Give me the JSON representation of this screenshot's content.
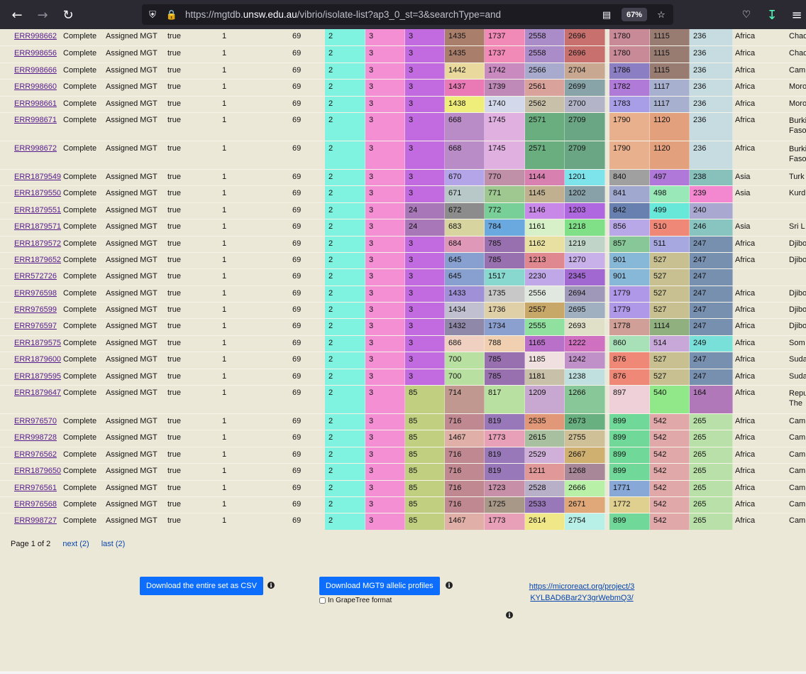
{
  "browser": {
    "url_prefix": "https://mgtdb.",
    "url_host": "unsw.edu.au",
    "url_rest": "/vibrio/isolate-list?ap3_0_st=3&searchType=and",
    "zoom": "67%",
    "icons": [
      "back-icon",
      "forward-icon",
      "reload-icon",
      "shield-icon",
      "lock-icon",
      "reader-view-icon",
      "bookmark-star-icon",
      "pocket-icon",
      "download-icon",
      "menu-icon"
    ]
  },
  "rows": [
    {
      "acc": "ERR998662",
      "status": "Complete",
      "assign": "Assigned MGT",
      "flag": "true",
      "one": "1",
      "st": "69",
      "vals": [
        "2",
        "3",
        "3",
        "1435",
        "1737",
        "2558",
        "2696",
        "1780",
        "1115",
        "236"
      ],
      "region": "Africa",
      "country": "Chad"
    },
    {
      "acc": "ERR998656",
      "status": "Complete",
      "assign": "Assigned MGT",
      "flag": "true",
      "one": "1",
      "st": "69",
      "vals": [
        "2",
        "3",
        "3",
        "1435",
        "1737",
        "2558",
        "2696",
        "1780",
        "1115",
        "236"
      ],
      "region": "Africa",
      "country": "Chad"
    },
    {
      "acc": "ERR998666",
      "status": "Complete",
      "assign": "Assigned MGT",
      "flag": "true",
      "one": "1",
      "st": "69",
      "vals": [
        "2",
        "3",
        "3",
        "1442",
        "1742",
        "2566",
        "2704",
        "1786",
        "1115",
        "236"
      ],
      "region": "Africa",
      "country": "Cam"
    },
    {
      "acc": "ERR998660",
      "status": "Complete",
      "assign": "Assigned MGT",
      "flag": "true",
      "one": "1",
      "st": "69",
      "vals": [
        "2",
        "3",
        "3",
        "1437",
        "1739",
        "2561",
        "2699",
        "1782",
        "1117",
        "236"
      ],
      "region": "Africa",
      "country": "Moro"
    },
    {
      "acc": "ERR998661",
      "status": "Complete",
      "assign": "Assigned MGT",
      "flag": "true",
      "one": "1",
      "st": "69",
      "vals": [
        "2",
        "3",
        "3",
        "1438",
        "1740",
        "2562",
        "2700",
        "1783",
        "1117",
        "236"
      ],
      "region": "Africa",
      "country": "Moro"
    },
    {
      "acc": "ERR998671",
      "status": "Complete",
      "assign": "Assigned MGT",
      "flag": "true",
      "one": "1",
      "st": "69",
      "vals": [
        "2",
        "3",
        "3",
        "668",
        "1745",
        "2571",
        "2709",
        "1790",
        "1120",
        "236"
      ],
      "region": "Africa",
      "country": "Burkina Faso"
    },
    {
      "acc": "ERR998672",
      "status": "Complete",
      "assign": "Assigned MGT",
      "flag": "true",
      "one": "1",
      "st": "69",
      "vals": [
        "2",
        "3",
        "3",
        "668",
        "1745",
        "2571",
        "2709",
        "1790",
        "1120",
        "236"
      ],
      "region": "Africa",
      "country": "Burkina Faso"
    },
    {
      "acc": "ERR1879549",
      "status": "Complete",
      "assign": "Assigned MGT",
      "flag": "true",
      "one": "1",
      "st": "69",
      "vals": [
        "2",
        "3",
        "3",
        "670",
        "770",
        "1144",
        "1201",
        "840",
        "497",
        "238"
      ],
      "region": "Asia",
      "country": "Turk"
    },
    {
      "acc": "ERR1879550",
      "status": "Complete",
      "assign": "Assigned MGT",
      "flag": "true",
      "one": "1",
      "st": "69",
      "vals": [
        "2",
        "3",
        "3",
        "671",
        "771",
        "1145",
        "1202",
        "841",
        "498",
        "239"
      ],
      "region": "Asia",
      "country": "Kurd"
    },
    {
      "acc": "ERR1879551",
      "status": "Complete",
      "assign": "Assigned MGT",
      "flag": "true",
      "one": "1",
      "st": "69",
      "vals": [
        "2",
        "3",
        "24",
        "672",
        "772",
        "1146",
        "1203",
        "842",
        "499",
        "240"
      ],
      "region": "",
      "country": ""
    },
    {
      "acc": "ERR1879571",
      "status": "Complete",
      "assign": "Assigned MGT",
      "flag": "true",
      "one": "1",
      "st": "69",
      "vals": [
        "2",
        "3",
        "24",
        "683",
        "784",
        "1161",
        "1218",
        "856",
        "510",
        "246"
      ],
      "region": "Asia",
      "country": "Sri L"
    },
    {
      "acc": "ERR1879572",
      "status": "Complete",
      "assign": "Assigned MGT",
      "flag": "true",
      "one": "1",
      "st": "69",
      "vals": [
        "2",
        "3",
        "3",
        "684",
        "785",
        "1162",
        "1219",
        "857",
        "511",
        "247"
      ],
      "region": "Africa",
      "country": "Djibo"
    },
    {
      "acc": "ERR1879652",
      "status": "Complete",
      "assign": "Assigned MGT",
      "flag": "true",
      "one": "1",
      "st": "69",
      "vals": [
        "2",
        "3",
        "3",
        "645",
        "785",
        "1213",
        "1270",
        "901",
        "527",
        "247"
      ],
      "region": "Africa",
      "country": "Djibo"
    },
    {
      "acc": "ERR572726",
      "status": "Complete",
      "assign": "Assigned MGT",
      "flag": "true",
      "one": "1",
      "st": "69",
      "vals": [
        "2",
        "3",
        "3",
        "645",
        "1517",
        "2230",
        "2345",
        "901",
        "527",
        "247"
      ],
      "region": "",
      "country": ""
    },
    {
      "acc": "ERR976598",
      "status": "Complete",
      "assign": "Assigned MGT",
      "flag": "true",
      "one": "1",
      "st": "69",
      "vals": [
        "2",
        "3",
        "3",
        "1433",
        "1735",
        "2556",
        "2694",
        "1779",
        "527",
        "247"
      ],
      "region": "Africa",
      "country": "Djibo"
    },
    {
      "acc": "ERR976599",
      "status": "Complete",
      "assign": "Assigned MGT",
      "flag": "true",
      "one": "1",
      "st": "69",
      "vals": [
        "2",
        "3",
        "3",
        "1434",
        "1736",
        "2557",
        "2695",
        "1779",
        "527",
        "247"
      ],
      "region": "Africa",
      "country": "Djibo"
    },
    {
      "acc": "ERR976597",
      "status": "Complete",
      "assign": "Assigned MGT",
      "flag": "true",
      "one": "1",
      "st": "69",
      "vals": [
        "2",
        "3",
        "3",
        "1432",
        "1734",
        "2555",
        "2693",
        "1778",
        "1114",
        "247"
      ],
      "region": "Africa",
      "country": "Djibo"
    },
    {
      "acc": "ERR1879575",
      "status": "Complete",
      "assign": "Assigned MGT",
      "flag": "true",
      "one": "1",
      "st": "69",
      "vals": [
        "2",
        "3",
        "3",
        "686",
        "788",
        "1165",
        "1222",
        "860",
        "514",
        "249"
      ],
      "region": "Africa",
      "country": "Som"
    },
    {
      "acc": "ERR1879600",
      "status": "Complete",
      "assign": "Assigned MGT",
      "flag": "true",
      "one": "1",
      "st": "69",
      "vals": [
        "2",
        "3",
        "3",
        "700",
        "785",
        "1185",
        "1242",
        "876",
        "527",
        "247"
      ],
      "region": "Africa",
      "country": "Suda"
    },
    {
      "acc": "ERR1879595",
      "status": "Complete",
      "assign": "Assigned MGT",
      "flag": "true",
      "one": "1",
      "st": "69",
      "vals": [
        "2",
        "3",
        "3",
        "700",
        "785",
        "1181",
        "1238",
        "876",
        "527",
        "247"
      ],
      "region": "Africa",
      "country": "Suda"
    },
    {
      "acc": "ERR1879647",
      "status": "Complete",
      "assign": "Assigned MGT",
      "flag": "true",
      "one": "1",
      "st": "69",
      "vals": [
        "2",
        "3",
        "85",
        "714",
        "817",
        "1209",
        "1266",
        "897",
        "540",
        "164"
      ],
      "region": "Africa",
      "country": "Repu The"
    },
    {
      "acc": "ERR976570",
      "status": "Complete",
      "assign": "Assigned MGT",
      "flag": "true",
      "one": "1",
      "st": "69",
      "vals": [
        "2",
        "3",
        "85",
        "716",
        "819",
        "2535",
        "2673",
        "899",
        "542",
        "265"
      ],
      "region": "Africa",
      "country": "Cam"
    },
    {
      "acc": "ERR998728",
      "status": "Complete",
      "assign": "Assigned MGT",
      "flag": "true",
      "one": "1",
      "st": "69",
      "vals": [
        "2",
        "3",
        "85",
        "1467",
        "1773",
        "2615",
        "2755",
        "899",
        "542",
        "265"
      ],
      "region": "Africa",
      "country": "Cam"
    },
    {
      "acc": "ERR976562",
      "status": "Complete",
      "assign": "Assigned MGT",
      "flag": "true",
      "one": "1",
      "st": "69",
      "vals": [
        "2",
        "3",
        "85",
        "716",
        "819",
        "2529",
        "2667",
        "899",
        "542",
        "265"
      ],
      "region": "Africa",
      "country": "Cam"
    },
    {
      "acc": "ERR1879650",
      "status": "Complete",
      "assign": "Assigned MGT",
      "flag": "true",
      "one": "1",
      "st": "69",
      "vals": [
        "2",
        "3",
        "85",
        "716",
        "819",
        "1211",
        "1268",
        "899",
        "542",
        "265"
      ],
      "region": "Africa",
      "country": "Cam"
    },
    {
      "acc": "ERR976561",
      "status": "Complete",
      "assign": "Assigned MGT",
      "flag": "true",
      "one": "1",
      "st": "69",
      "vals": [
        "2",
        "3",
        "85",
        "716",
        "1723",
        "2528",
        "2666",
        "1771",
        "542",
        "265"
      ],
      "region": "Africa",
      "country": "Cam"
    },
    {
      "acc": "ERR976568",
      "status": "Complete",
      "assign": "Assigned MGT",
      "flag": "true",
      "one": "1",
      "st": "69",
      "vals": [
        "2",
        "3",
        "85",
        "716",
        "1725",
        "2533",
        "2671",
        "1772",
        "542",
        "265"
      ],
      "region": "Africa",
      "country": "Cam"
    },
    {
      "acc": "ERR998727",
      "status": "Complete",
      "assign": "Assigned MGT",
      "flag": "true",
      "one": "1",
      "st": "69",
      "vals": [
        "2",
        "3",
        "85",
        "1467",
        "1773",
        "2614",
        "2754",
        "899",
        "542",
        "265"
      ],
      "region": "Africa",
      "country": "Cam"
    }
  ],
  "cell_colors": [
    [
      "#7ff2e0",
      "#f48fd4",
      "#c26be0",
      "#a97f6c",
      "#f28ab8",
      "#a98cc8",
      "#c8706e",
      "#c98a98",
      "#987c72",
      "#c7dce0"
    ],
    [
      "#7ff2e0",
      "#f48fd4",
      "#c26be0",
      "#a97f6c",
      "#f28ab8",
      "#a98cc8",
      "#c8706e",
      "#c98a98",
      "#987c72",
      "#c7dce0"
    ],
    [
      "#7ff2e0",
      "#f48fd4",
      "#c26be0",
      "#e9d99c",
      "#c98ac0",
      "#a9abce",
      "#c8a890",
      "#8c7ec2",
      "#987c72",
      "#c7dce0"
    ],
    [
      "#7ff2e0",
      "#f48fd4",
      "#c26be0",
      "#e97ab6",
      "#c08ab8",
      "#d9a39c",
      "#88a4a8",
      "#b07ad8",
      "#a8b0d0",
      "#c7dce0"
    ],
    [
      "#7ff2e0",
      "#f48fd4",
      "#c26be0",
      "#f0ee7a",
      "#d3d8ea",
      "#c8c0a8",
      "#b4b4c8",
      "#a89ee8",
      "#a8b0d0",
      "#c7dce0"
    ],
    [
      "#7ff2e0",
      "#f48fd4",
      "#c26be0",
      "#b98cc8",
      "#e0b0e0",
      "#6aae80",
      "#6aa684",
      "#e8b08c",
      "#e2a07c",
      "#c7dce0"
    ],
    [
      "#7ff2e0",
      "#f48fd4",
      "#c26be0",
      "#b98cc8",
      "#e0b0e0",
      "#6aae80",
      "#6aa684",
      "#e8b08c",
      "#e2a07c",
      "#c7dce0"
    ],
    [
      "#7ff2e0",
      "#f48fd4",
      "#c26be0",
      "#b4a4e8",
      "#c090a8",
      "#d880b0",
      "#7ee4ec",
      "#a0a0a0",
      "#b078d8",
      "#88c0bc"
    ],
    [
      "#7ff2e0",
      "#f48fd4",
      "#c26be0",
      "#b8c8c8",
      "#9ec890",
      "#c0b090",
      "#88a0a8",
      "#a0a8d0",
      "#98e8b8",
      "#f488d0"
    ],
    [
      "#7ff2e0",
      "#f48fd4",
      "#a877b8",
      "#8c8c8c",
      "#78d098",
      "#c888e8",
      "#b068e0",
      "#6880b0",
      "#68e8d8",
      "#a8a8d0"
    ],
    [
      "#7ff2e0",
      "#f48fd4",
      "#a877b8",
      "#d8d4a0",
      "#6aa8e0",
      "#d8f0c8",
      "#80e088",
      "#b8a8e8",
      "#f08878",
      "#88c4c0"
    ],
    [
      "#7ff2e0",
      "#f48fd4",
      "#c26be0",
      "#e098b8",
      "#9870b0",
      "#e8e0a0",
      "#c0d4c8",
      "#88c898",
      "#a8a8e0",
      "#7890b0"
    ],
    [
      "#7ff2e0",
      "#f48fd4",
      "#c26be0",
      "#88a0d0",
      "#9870b0",
      "#e08890",
      "#c8b0e8",
      "#88b8d8",
      "#c8c090",
      "#7890b0"
    ],
    [
      "#7ff2e0",
      "#f48fd4",
      "#c26be0",
      "#88a0d0",
      "#88d8d0",
      "#c0a8e8",
      "#a068d0",
      "#88b8d8",
      "#c8c090",
      "#7890b0"
    ],
    [
      "#7ff2e0",
      "#f48fd4",
      "#c26be0",
      "#a090d8",
      "#c8c8c8",
      "#e0e8e0",
      "#a098b8",
      "#b098e8",
      "#c8c090",
      "#7890b0"
    ],
    [
      "#7ff2e0",
      "#f48fd4",
      "#c26be0",
      "#c0c0d0",
      "#e0d0a8",
      "#c8a868",
      "#a0b0c0",
      "#b098e8",
      "#c8c090",
      "#7890b0"
    ],
    [
      "#7ff2e0",
      "#f48fd4",
      "#c26be0",
      "#9088a8",
      "#8ca0d0",
      "#90e0a0",
      "#e0e0c8",
      "#d0a098",
      "#90b080",
      "#7890b0"
    ],
    [
      "#7ff2e0",
      "#f48fd4",
      "#c26be0",
      "#f0d0c0",
      "#f0d0b0",
      "#b870c8",
      "#d070c0",
      "#a8e0b8",
      "#c8a8d8",
      "#78e0d8"
    ],
    [
      "#7ff2e0",
      "#f48fd4",
      "#c26be0",
      "#b8e0a0",
      "#9870b0",
      "#f0e0e0",
      "#c090c8",
      "#f08878",
      "#c8c090",
      "#7890b0"
    ],
    [
      "#7ff2e0",
      "#f48fd4",
      "#c26be0",
      "#b8e0a0",
      "#9870b0",
      "#c8c0a8",
      "#c0e0e0",
      "#f08878",
      "#c8c090",
      "#7890b0"
    ],
    [
      "#7ff2e0",
      "#f48fd4",
      "#c0d080",
      "#c09890",
      "#b8e0a0",
      "#c8a8d0",
      "#88c898",
      "#f0d0d8",
      "#90e888",
      "#b078b8"
    ],
    [
      "#7ff2e0",
      "#f48fd4",
      "#c0d080",
      "#c08890",
      "#9878b8",
      "#e09878",
      "#68b080",
      "#70d898",
      "#e0a8a8",
      "#b8e0a8"
    ],
    [
      "#7ff2e0",
      "#f48fd4",
      "#c0d080",
      "#e0b0a8",
      "#e8a0b8",
      "#a8c0a0",
      "#d0c098",
      "#70d898",
      "#e0a8a8",
      "#b8e0a8"
    ],
    [
      "#7ff2e0",
      "#f48fd4",
      "#c0d080",
      "#c08890",
      "#9878b8",
      "#d0b0d8",
      "#d0b070",
      "#70d898",
      "#e0a8a8",
      "#b8e0a8"
    ],
    [
      "#7ff2e0",
      "#f48fd4",
      "#c0d080",
      "#c08890",
      "#9878b8",
      "#e09898",
      "#a88898",
      "#70d898",
      "#e0a8a8",
      "#b8e0a8"
    ],
    [
      "#7ff2e0",
      "#f48fd4",
      "#c0d080",
      "#c08890",
      "#c890a8",
      "#b8b0c8",
      "#b8f0a8",
      "#88a8d8",
      "#e0a8a8",
      "#b8e0a8"
    ],
    [
      "#7ff2e0",
      "#f48fd4",
      "#c0d080",
      "#c08890",
      "#a89888",
      "#9878b8",
      "#e0a878",
      "#e0d090",
      "#e0a8a8",
      "#b8e0a8"
    ],
    [
      "#7ff2e0",
      "#f48fd4",
      "#c0d080",
      "#e0b0a8",
      "#e8a0b8",
      "#f0e888",
      "#b8f0e8",
      "#70d898",
      "#e0a8a8",
      "#b8e0a8"
    ]
  ],
  "pager": {
    "text": "Page 1 of 2",
    "next": "next (2)",
    "last": "last (2)"
  },
  "actions": {
    "csv_label": "Download the entire set as CSV",
    "mgt9_label": "Download MGT9 allelic profiles",
    "grapetree_label": "In GrapeTree format",
    "microreact_link": "https://microreact.org/project/3KYLBAD6Bar2Y3grWebmQ3/"
  }
}
